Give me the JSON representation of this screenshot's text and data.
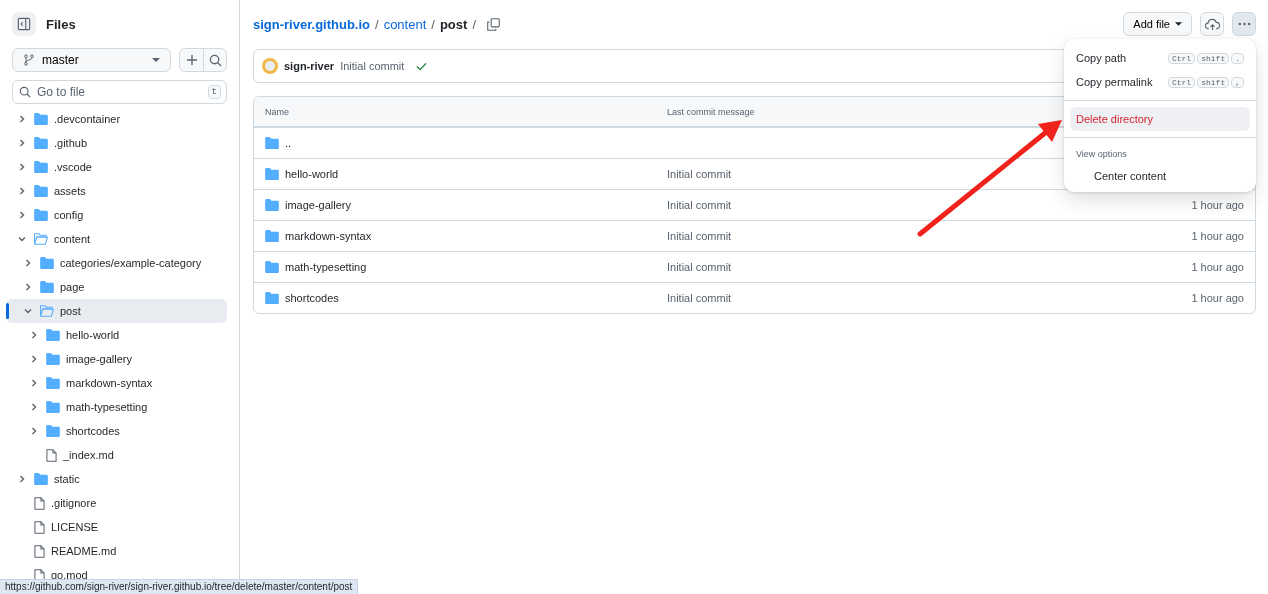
{
  "sidebar": {
    "title": "Files",
    "branch": "master",
    "search": {
      "placeholder": "Go to file",
      "shortcut": "t"
    },
    "tree": [
      {
        "name": ".devcontainer",
        "kind": "folder",
        "expanded": false,
        "selected": false
      },
      {
        "name": ".github",
        "kind": "folder",
        "expanded": false,
        "selected": false
      },
      {
        "name": ".vscode",
        "kind": "folder",
        "expanded": false,
        "selected": false
      },
      {
        "name": "assets",
        "kind": "folder",
        "expanded": false,
        "selected": false
      },
      {
        "name": "config",
        "kind": "folder",
        "expanded": false,
        "selected": false
      },
      {
        "name": "content",
        "kind": "folder",
        "expanded": true,
        "selected": false,
        "children": [
          {
            "name": "categories/example-category",
            "kind": "folder",
            "expanded": false,
            "selected": false
          },
          {
            "name": "page",
            "kind": "folder",
            "expanded": false,
            "selected": false
          },
          {
            "name": "post",
            "kind": "folder",
            "expanded": true,
            "selected": true,
            "children": [
              {
                "name": "hello-world",
                "kind": "folder",
                "expanded": false,
                "selected": false
              },
              {
                "name": "image-gallery",
                "kind": "folder",
                "expanded": false,
                "selected": false
              },
              {
                "name": "markdown-syntax",
                "kind": "folder",
                "expanded": false,
                "selected": false
              },
              {
                "name": "math-typesetting",
                "kind": "folder",
                "expanded": false,
                "selected": false
              },
              {
                "name": "shortcodes",
                "kind": "folder",
                "expanded": false,
                "selected": false
              },
              {
                "name": "_index.md",
                "kind": "file",
                "selected": false
              }
            ]
          }
        ]
      },
      {
        "name": "static",
        "kind": "folder",
        "expanded": false,
        "selected": false
      },
      {
        "name": ".gitignore",
        "kind": "file",
        "selected": false
      },
      {
        "name": "LICENSE",
        "kind": "file",
        "selected": false
      },
      {
        "name": "README.md",
        "kind": "file",
        "selected": false
      },
      {
        "name": "go.mod",
        "kind": "file",
        "selected": false
      }
    ]
  },
  "breadcrumb": [
    {
      "label": "sign-river.github.io",
      "kind": "link"
    },
    {
      "label": "/",
      "kind": "separator"
    },
    {
      "label": "content",
      "kind": "link"
    },
    {
      "label": "/",
      "kind": "separator"
    },
    {
      "label": "post",
      "kind": "current"
    },
    {
      "label": "/",
      "kind": "separator"
    }
  ],
  "actions": {
    "add_file": "Add file",
    "more_open": true
  },
  "commit": {
    "author": "sign-river",
    "message": "Initial commit",
    "checks_passed": true
  },
  "table": {
    "columns": [
      "Name",
      "Last commit message"
    ],
    "rows": [
      {
        "name": ".."
      },
      {
        "name": "hello-world",
        "message": "Initial commit"
      },
      {
        "name": "image-gallery",
        "message": "Initial commit",
        "date": "1 hour ago"
      },
      {
        "name": "markdown-syntax",
        "message": "Initial commit",
        "date": "1 hour ago"
      },
      {
        "name": "math-typesetting",
        "message": "Initial commit",
        "date": "1 hour ago"
      },
      {
        "name": "shortcodes",
        "message": "Initial commit",
        "date": "1 hour ago"
      }
    ]
  },
  "menu": [
    {
      "kind": "item",
      "label": "Copy path",
      "keys": [
        "Ctrl",
        "shift",
        "."
      ],
      "selected": false
    },
    {
      "kind": "item",
      "label": "Copy permalink",
      "keys": [
        "Ctrl",
        "shift",
        ","
      ],
      "selected": false
    },
    {
      "kind": "divider"
    },
    {
      "kind": "item",
      "label": "Delete directory",
      "danger": true,
      "selected": true
    },
    {
      "kind": "divider"
    },
    {
      "kind": "heading",
      "label": "View options"
    },
    {
      "kind": "option",
      "label": "Center content"
    }
  ],
  "status_bar": {
    "url": "https://github.com/sign-river/sign-river.github.io/tree/delete/master/content/post"
  }
}
